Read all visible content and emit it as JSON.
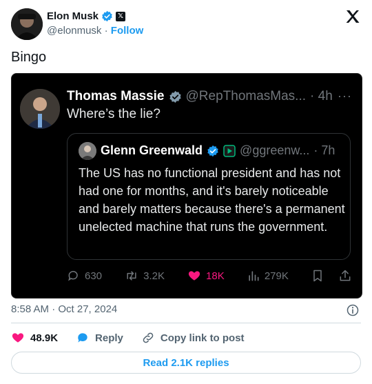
{
  "post": {
    "author": {
      "name": "Elon Musk",
      "handle": "@elonmusk",
      "follow_label": "Follow"
    },
    "text": "Bingo",
    "timestamp": "8:58 AM · Oct 27, 2024"
  },
  "screenshot": {
    "author": {
      "name": "Thomas Massie",
      "handle": "@RepThomasMas...",
      "time": "· 4h"
    },
    "text": "Where’s the lie?",
    "quote": {
      "author": {
        "name": "Glenn Greenwald",
        "handle": "@ggreenw...",
        "time": "· 7h"
      },
      "text": "The US has no functional president and has not had one for months, and it's barely noticeable and barely matters because there's a permanent unelected machine that runs the government."
    },
    "actions": {
      "replies": "630",
      "reposts": "3.2K",
      "likes": "18K",
      "views": "279K"
    }
  },
  "footer": {
    "likes": "48.9K",
    "reply_label": "Reply",
    "copy_label": "Copy link to post",
    "read_replies_label": "Read 2.1K replies"
  },
  "colors": {
    "accent": "#1d9bf0",
    "like": "#f91880",
    "muted": "#536471",
    "dark_bg": "#000000"
  }
}
